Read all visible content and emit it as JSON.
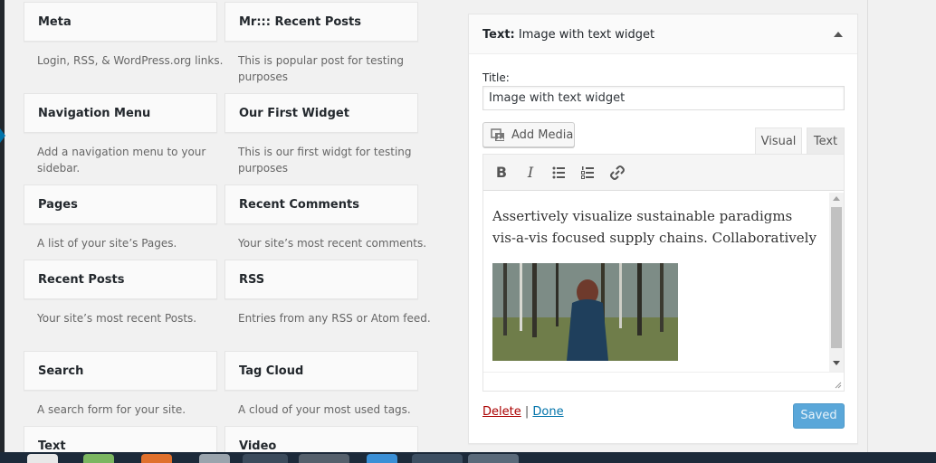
{
  "available_widgets": [
    {
      "title": "Meta",
      "desc": "Login, RSS, & WordPress.org links."
    },
    {
      "title": "Mr::: Recent Posts",
      "desc": "This is popular post for testing purposes"
    },
    {
      "title": "Navigation Menu",
      "desc": "Add a navigation menu to your sidebar."
    },
    {
      "title": "Our First Widget",
      "desc": "This is our first widgt for testing purposes"
    },
    {
      "title": "Pages",
      "desc": "A list of your site’s Pages."
    },
    {
      "title": "Recent Comments",
      "desc": "Your site’s most recent comments."
    },
    {
      "title": "Recent Posts",
      "desc": "Your site’s most recent Posts."
    },
    {
      "title": "RSS",
      "desc": "Entries from any RSS or Atom feed."
    },
    {
      "title": "Search",
      "desc": "A search form for your site."
    },
    {
      "title": "Tag Cloud",
      "desc": "A cloud of your most used tags."
    },
    {
      "title": "Text",
      "desc": ""
    },
    {
      "title": "Video",
      "desc": ""
    }
  ],
  "widget": {
    "header_prefix": "Text:",
    "header_name": "Image with text widget",
    "title_label": "Title:",
    "title_value": "Image with text widget",
    "add_media_label": "Add Media",
    "tab_visual": "Visual",
    "tab_text": "Text",
    "toolbar_icons": [
      "bold-icon",
      "italic-icon",
      "bulleted-list-icon",
      "numbered-list-icon",
      "link-icon"
    ],
    "content_text": "Assertively visualize sustainable paradigms vis-a-vis focused supply chains. Collaboratively",
    "delete_label": "Delete",
    "separator": "|",
    "done_label": "Done",
    "saved_label": "Saved"
  },
  "colors": {
    "accent": "#0073aa",
    "delete": "#a00000",
    "saved_button": "#5aa7d9"
  }
}
